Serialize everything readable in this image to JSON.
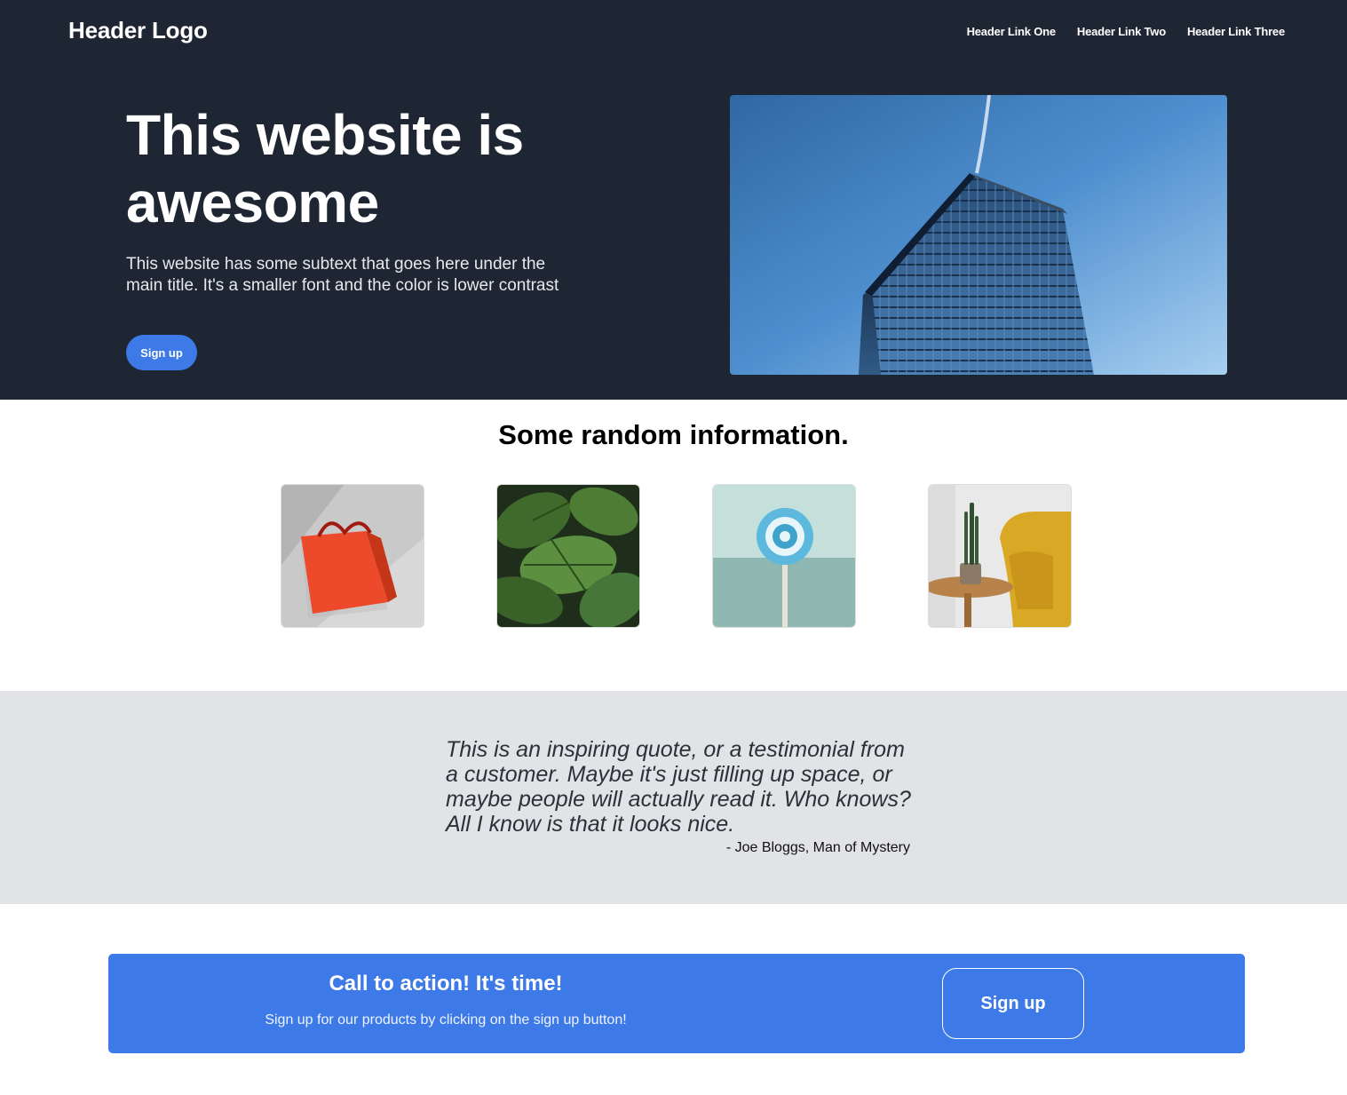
{
  "header": {
    "logo": "Header Logo",
    "links": [
      "Header Link One",
      "Header Link Two",
      "Header Link Three"
    ]
  },
  "hero": {
    "title": "This website is awesome",
    "subtitle": "This website has some subtext that goes here under the main title. It's a smaller font and the color is lower contrast",
    "button": "Sign up",
    "image_icon": "building-photo"
  },
  "info": {
    "title": "Some random information.",
    "images": [
      "shopping-bag-photo",
      "plant-leaves-photo",
      "lollipop-photo",
      "chair-cactus-photo"
    ]
  },
  "quote": {
    "text": "This is an inspiring quote, or a testimonial from a customer. Maybe it's just filling up space, or maybe people will actually read it. Who knows? All I know is that it looks nice.",
    "author": "- Joe Bloggs, Man of Mystery"
  },
  "cta": {
    "title": "Call to action! It's time!",
    "subtitle": "Sign up for our products by clicking on the sign up button!",
    "button": "Sign up"
  },
  "colors": {
    "dark_bg": "#1f2633",
    "accent": "#3d7ae8",
    "quote_bg": "#e2e3e7"
  }
}
